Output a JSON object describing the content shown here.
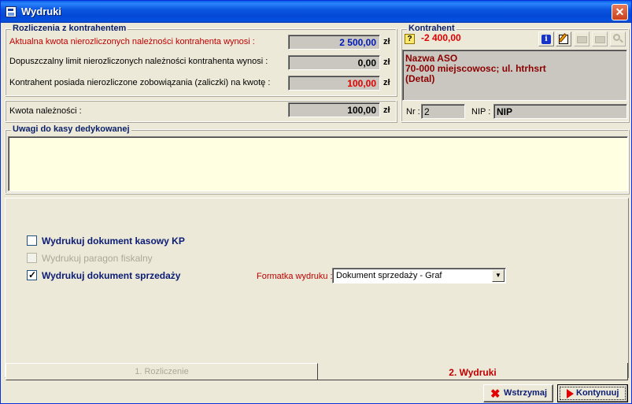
{
  "window": {
    "title": "Wydruki"
  },
  "settlements": {
    "title": "Rozliczenia z kontrahentem",
    "rows": [
      {
        "label": "Aktualna kwota nierozliczonych należności  kontrahenta wynosi :",
        "value": "2 500,00",
        "unit": "zł"
      },
      {
        "label": "Dopuszczalny limit nierozliczonych należności kontrahenta wynosi :",
        "value": "0,00",
        "unit": "zł"
      },
      {
        "label": "Kontrahent posiada nierozliczone zobowiązania (zaliczki) na kwotę :",
        "value": "100,00",
        "unit": "zł"
      }
    ]
  },
  "amount": {
    "label": "Kwota należności :",
    "value": "100,00",
    "unit": "zł"
  },
  "contractor": {
    "title": "Kontrahent",
    "balance": "-2 400,00",
    "help_mark": "?",
    "name": "Nazwa ASO",
    "address": "70-000 miejscowosc; ul. htrhsrt",
    "type": "(Detal)",
    "nr_label": "Nr :",
    "nr_value": "2",
    "nip_label": "NIP :",
    "nip_value": "NIP"
  },
  "notes": {
    "title": "Uwagi do kasy dedykowanej",
    "text": ""
  },
  "print_options": {
    "kp_label": "Wydrukuj dokument kasowy KP",
    "kp_checked": false,
    "receipt_label": "Wydrukuj paragon fiskalny",
    "receipt_checked": false,
    "sale_label": "Wydrukuj dokument sprzedaży",
    "sale_checked": true,
    "format_label": "Formatka wydruku :",
    "format_value": "Dokument sprzedaży - Graf"
  },
  "tabs": [
    {
      "label": "1. Rozliczenie",
      "active": false
    },
    {
      "label": "2. Wydruki",
      "active": true
    }
  ],
  "buttons": {
    "cancel_label": "Wstrzymaj",
    "continue_label": "Kontynuuj"
  },
  "colors": {
    "title_bar": "#0b56e0",
    "accent_red": "#c00000",
    "navy": "#0b1c75",
    "notes_bg": "#ffffe1"
  }
}
